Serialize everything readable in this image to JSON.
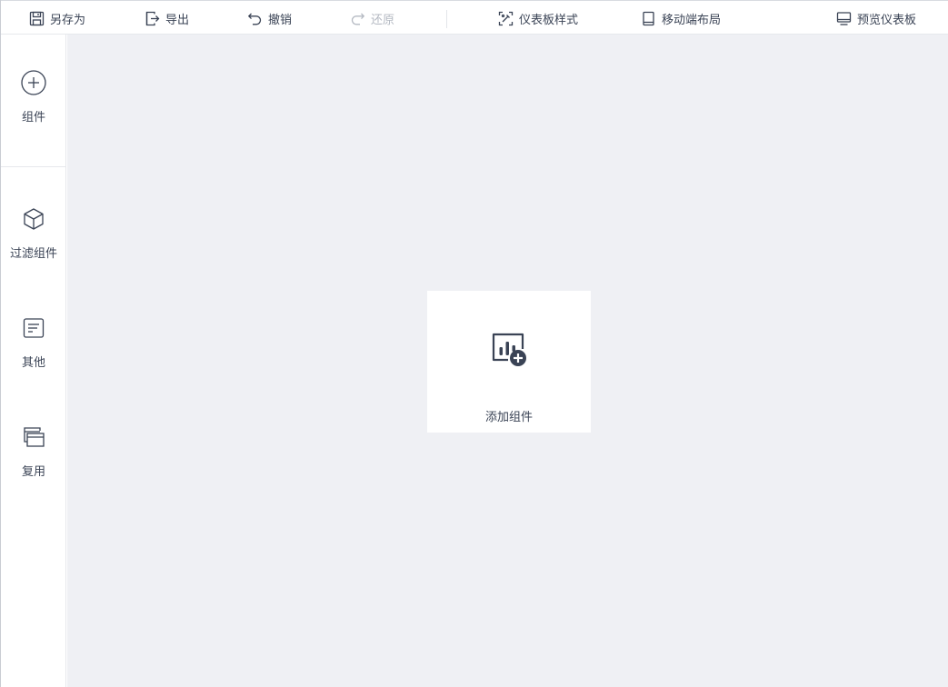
{
  "toolbar": {
    "save_as": "另存为",
    "export": "导出",
    "undo": "撤销",
    "redo": "还原",
    "dashboard_style": "仪表板样式",
    "mobile_layout": "移动端布局",
    "preview_dashboard": "预览仪表板"
  },
  "sidebar": {
    "items": [
      {
        "label": "组件",
        "icon": "plus-circle-icon"
      },
      {
        "label": "过滤组件",
        "icon": "cube-icon"
      },
      {
        "label": "其他",
        "icon": "document-lines-icon"
      },
      {
        "label": "复用",
        "icon": "windows-stack-icon"
      }
    ]
  },
  "canvas": {
    "add_widget_label": "添加组件",
    "add_widget_icon": "chart-add-icon"
  },
  "colors": {
    "text": "#3a4355",
    "icon": "#3a4355",
    "disabled": "#b4b9c2",
    "canvas_bg": "#eff0f4",
    "card_bg": "#ffffff"
  }
}
